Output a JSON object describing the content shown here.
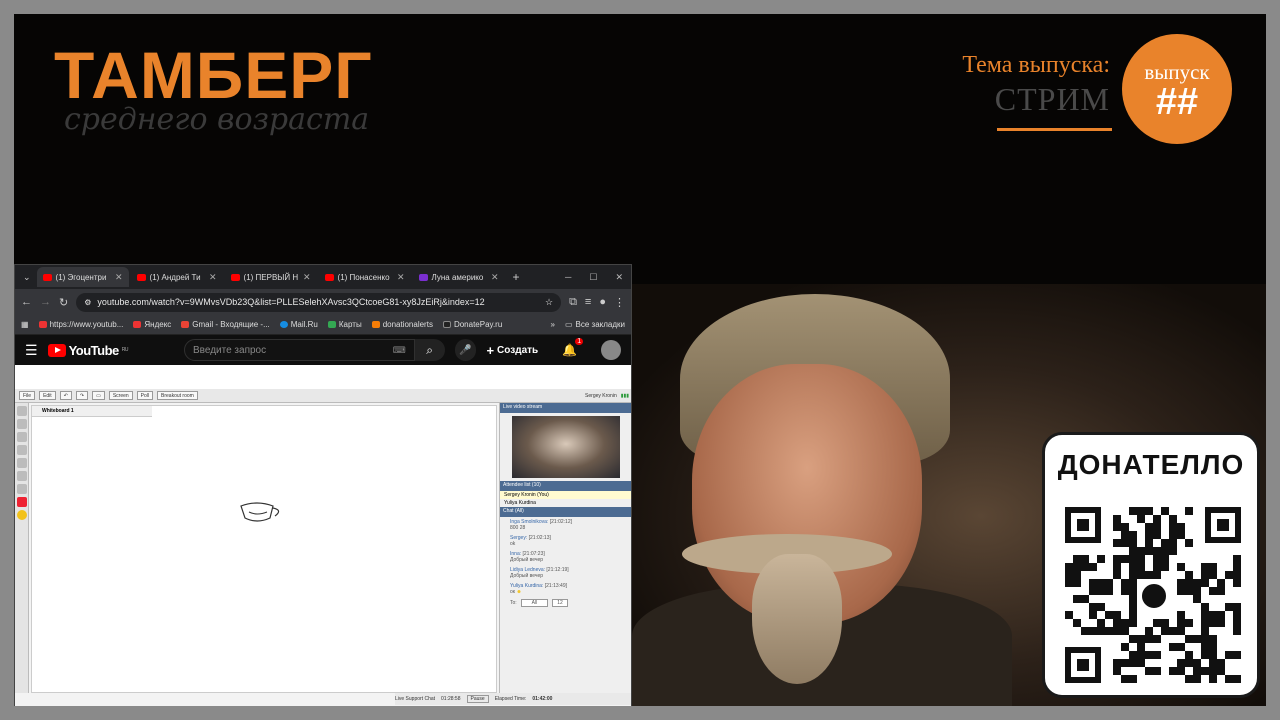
{
  "overlay": {
    "brand_title": "ТАМБЕРГ",
    "brand_subtitle": "среднего возраста",
    "theme_label": "Тема выпуска:",
    "theme_value": "СТРИМ",
    "episode_label": "выпуск",
    "episode_number": "##",
    "accent_color": "#e9832b"
  },
  "donate": {
    "title": "ДОНАТЕЛЛО"
  },
  "browser": {
    "tabs": [
      {
        "label": "(1) Эгоцентри",
        "active": true
      },
      {
        "label": "(1) Андрей Ти",
        "active": false
      },
      {
        "label": "(1) ПЕРВЫЙ Н",
        "active": false
      },
      {
        "label": "(1) Понасенко",
        "active": false
      },
      {
        "label": "Луна америко",
        "active": false
      }
    ],
    "url": "youtube.com/watch?v=9WMvsVDb23Q&list=PLLESelehXAvsc3QCtcoeG81-xy8JzEiRj&index=12",
    "bookmarks": [
      "https://www.youtub...",
      "Яндекс",
      "Gmail - Входящие -...",
      "Mail.Ru",
      "Карты",
      "donationalerts",
      "DonatePay.ru"
    ],
    "bookmarks_all": "Все закладки"
  },
  "youtube": {
    "logo": "YouTube",
    "region": "RU",
    "search_placeholder": "Введите запрос",
    "create_label": "Создать",
    "notif_count": "1"
  },
  "class_app": {
    "toolbar": [
      "File",
      "Edit",
      "Screen",
      "Poll",
      "Breakout room"
    ],
    "user": "Sergey Kronin",
    "whiteboard_tab": "Whiteboard 1",
    "video_header": "Live video stream",
    "attendee_header": "Attendee list (10)",
    "attendees": [
      "Sergey Kronin (You)",
      "Yuliya Kurdina"
    ],
    "chat_header": "Chat (All)",
    "chat": [
      {
        "name": "Inga Smolnikova:",
        "time": "[21:02:12]",
        "text": "800 28"
      },
      {
        "name": "Sergey:",
        "time": "[21:02:13]",
        "text": "ok"
      },
      {
        "name": "Inna:",
        "time": "[21:07:23]",
        "text": "Добрый вечер"
      },
      {
        "name": "Lidiya Ledneva:",
        "time": "[21:12:19]",
        "text": "Добрый вечер"
      },
      {
        "name": "Yuliya Kurdina:",
        "time": "[21:13:49]",
        "text": "ок"
      }
    ],
    "chat_to": "To:",
    "chat_to_value": "All",
    "font_size": "12",
    "live_support": "Live Support Chat",
    "time_left": "01:28:58",
    "pause": "Pause",
    "elapsed_label": "Elapsed Time:",
    "elapsed": "01:42:00"
  }
}
